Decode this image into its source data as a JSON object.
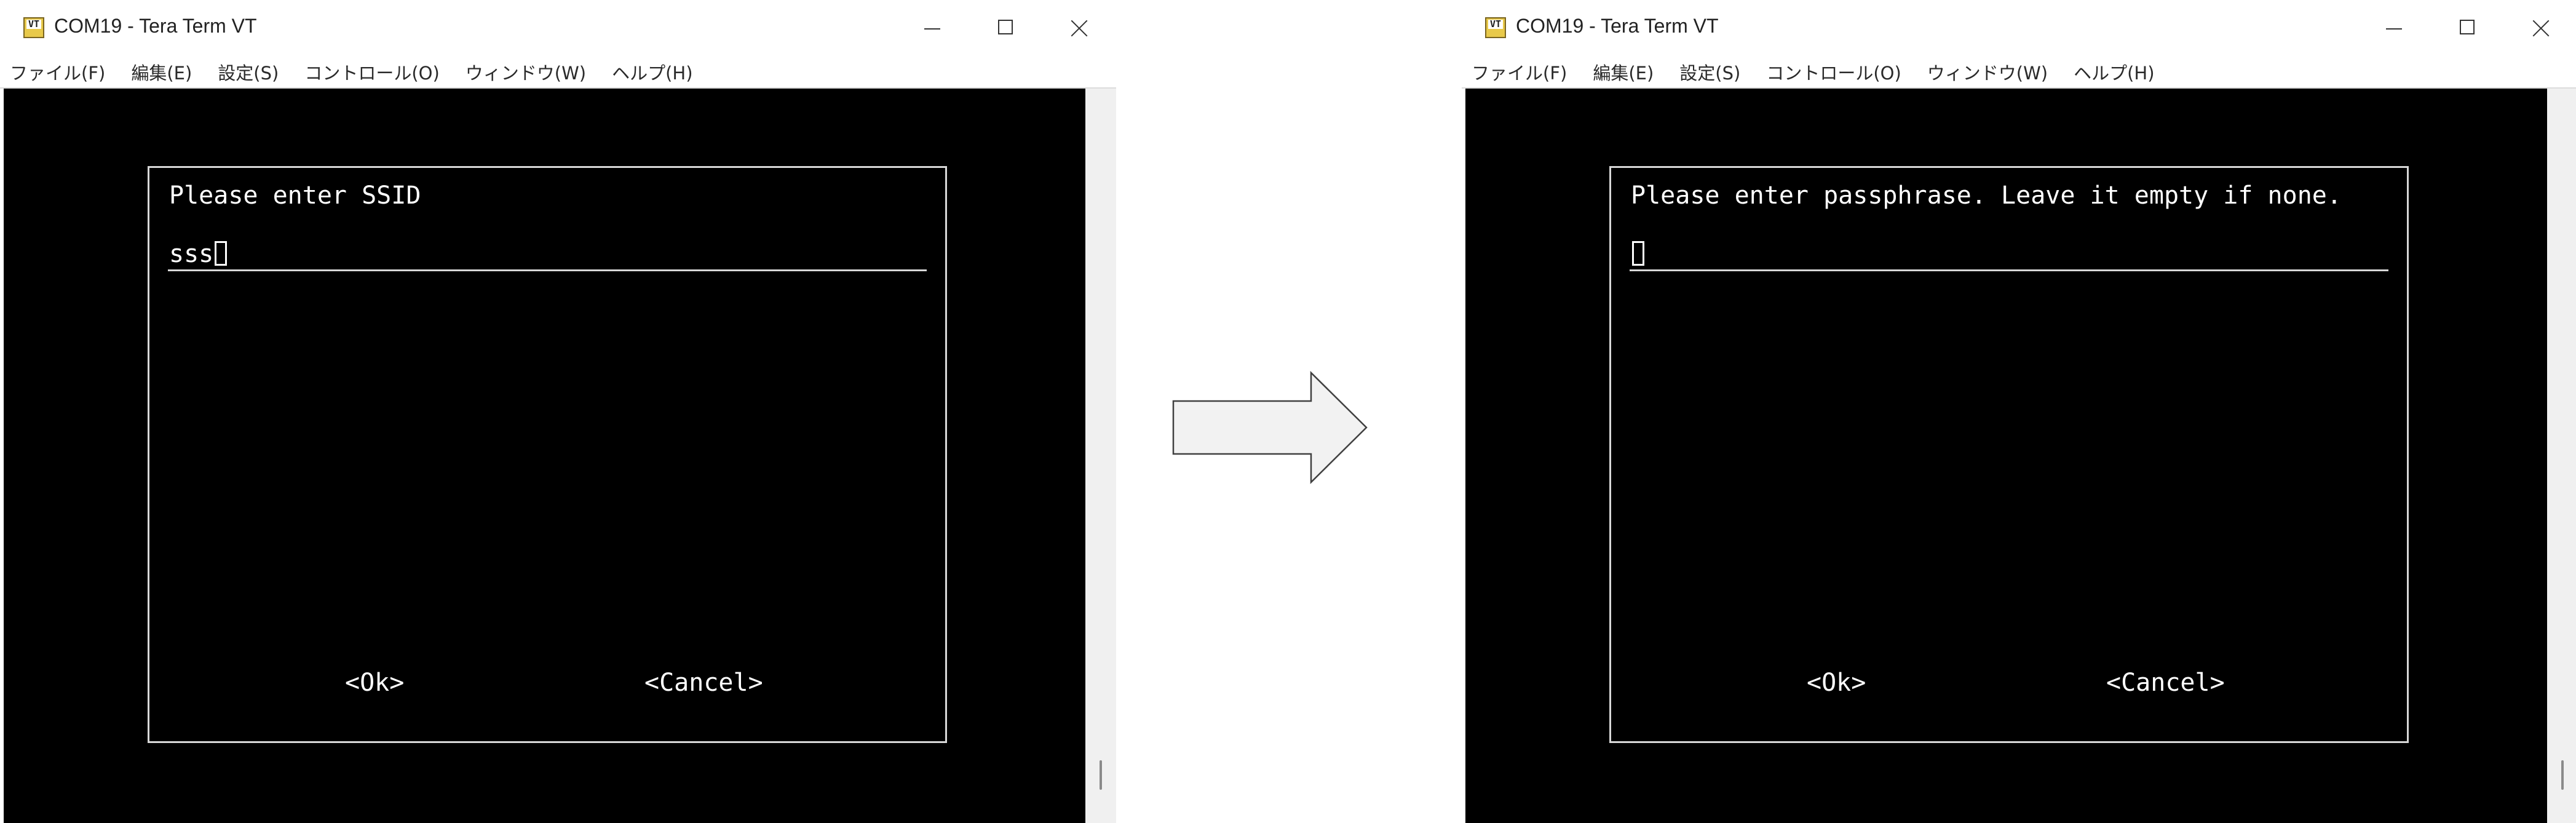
{
  "windows": [
    {
      "title": "COM19 - Tera Term VT",
      "icon": "tera-term-vt-icon",
      "icon_text": "VT",
      "menu": [
        "ファイル(F)",
        "編集(E)",
        "設定(S)",
        "コントロール(O)",
        "ウィンドウ(W)",
        "ヘルプ(H)"
      ],
      "dialog": {
        "prompt": "Please enter SSID",
        "input_value": "sss",
        "ok_label": "<Ok>",
        "cancel_label": "<Cancel>"
      }
    },
    {
      "title": "COM19 - Tera Term VT",
      "icon": "tera-term-vt-icon",
      "icon_text": "VT",
      "menu": [
        "ファイル(F)",
        "編集(E)",
        "設定(S)",
        "コントロール(O)",
        "ウィンドウ(W)",
        "ヘルプ(H)"
      ],
      "dialog": {
        "prompt": "Please enter passphrase. Leave it empty if none.",
        "input_value": "",
        "ok_label": "<Ok>",
        "cancel_label": "<Cancel>"
      }
    }
  ],
  "colors": {
    "terminal_bg": "#000000",
    "terminal_text": "#ffffff",
    "arrow_fill": "#f2f2f2",
    "arrow_stroke": "#404040"
  },
  "arrow": {
    "icon": "right-arrow-icon"
  }
}
